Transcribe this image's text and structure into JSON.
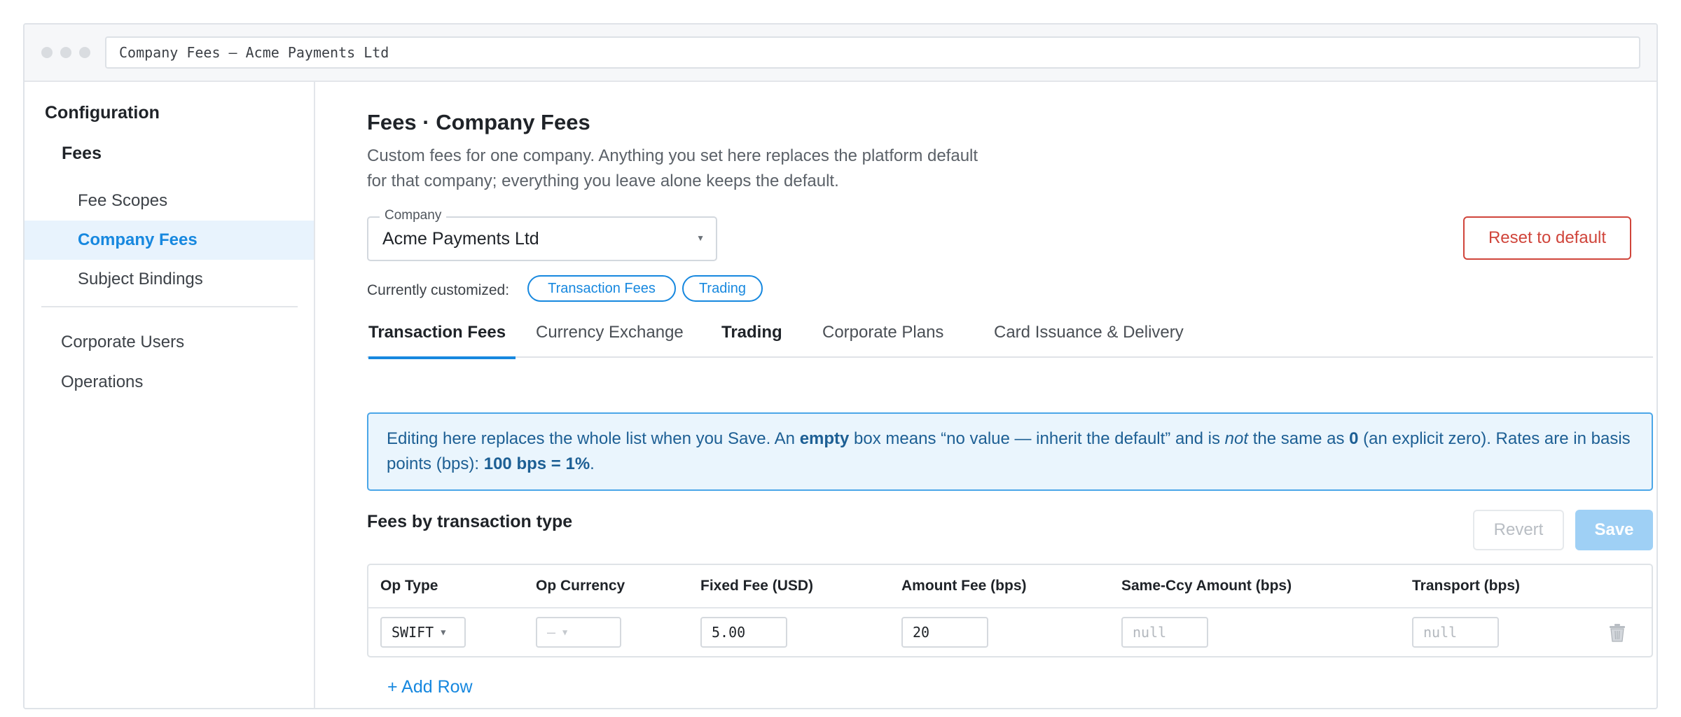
{
  "window": {
    "address": "Company Fees — Acme Payments Ltd"
  },
  "sidebar": {
    "header": "Configuration",
    "section": "Fees",
    "items": [
      {
        "label": "Fee Scopes"
      },
      {
        "label": "Company Fees"
      },
      {
        "label": "Subject Bindings"
      }
    ],
    "top_items": [
      {
        "label": "Corporate Users"
      },
      {
        "label": "Operations"
      }
    ]
  },
  "page": {
    "title": "Fees · Company Fees",
    "desc_line1": "Custom fees for one company. Anything you set here replaces the platform default",
    "desc_line2": "for that company; everything you leave alone keeps the default."
  },
  "company": {
    "label": "Company",
    "value": "Acme Payments Ltd"
  },
  "reset_label": "Reset to default",
  "customized": {
    "label": "Currently customized:",
    "chips": [
      "Transaction Fees",
      "Trading"
    ]
  },
  "tabs": [
    {
      "label": "Transaction Fees"
    },
    {
      "label": "Currency Exchange"
    },
    {
      "label": "Trading"
    },
    {
      "label": "Corporate Plans"
    },
    {
      "label": "Card Issuance & Delivery"
    }
  ],
  "info": {
    "t1": "Editing here replaces the whole list when you Save. An ",
    "b1": "empty",
    "t2": " box means “no value — inherit the default” and is ",
    "i1": "not",
    "t3": " the same as ",
    "b2": "0",
    "t4": " (an explicit zero). Rates are in basis points (bps): ",
    "b3": "100 bps = 1%",
    "t5": "."
  },
  "section": {
    "title": "Fees by transaction type",
    "revert": "Revert",
    "save": "Save"
  },
  "table": {
    "headers": [
      "Op Type",
      "Op Currency",
      "Fixed Fee (USD)",
      "Amount Fee (bps)",
      "Same-Ccy Amount (bps)",
      "Transport (bps)"
    ],
    "rows": [
      {
        "op_type": "SWIFT",
        "op_currency": "—",
        "fixed_fee": "5.00",
        "amount_fee": "20",
        "same_ccy_placeholder": "null",
        "transport_placeholder": "null"
      }
    ]
  },
  "add_row": "+ Add Row"
}
